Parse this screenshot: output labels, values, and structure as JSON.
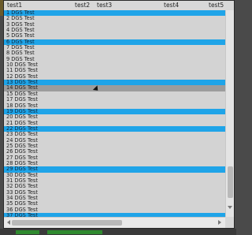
{
  "columns": [
    "test1",
    "test2",
    "test3",
    "test4",
    "test5"
  ],
  "rows": [
    {
      "label": "1 DGS Test",
      "state": "selected"
    },
    {
      "label": "2 DGS Test",
      "state": ""
    },
    {
      "label": "3 DGS Test",
      "state": ""
    },
    {
      "label": "4 DGS Test",
      "state": ""
    },
    {
      "label": "5 DGS Test",
      "state": ""
    },
    {
      "label": "6 DGS Test",
      "state": "selected"
    },
    {
      "label": "7 DGS Test",
      "state": ""
    },
    {
      "label": "8 DGS Test",
      "state": ""
    },
    {
      "label": "9 DGS Test",
      "state": ""
    },
    {
      "label": "10 DGS Test",
      "state": ""
    },
    {
      "label": "11 DGS Test",
      "state": ""
    },
    {
      "label": "12 DGS Test",
      "state": ""
    },
    {
      "label": "13 DGS Test",
      "state": "selected"
    },
    {
      "label": "14 DGS Test",
      "state": "hover"
    },
    {
      "label": "15 DGS Test",
      "state": ""
    },
    {
      "label": "17 DGS Test",
      "state": ""
    },
    {
      "label": "18 DGS Test",
      "state": ""
    },
    {
      "label": "19 DGS Test",
      "state": "selected"
    },
    {
      "label": "20 DGS Test",
      "state": ""
    },
    {
      "label": "21 DGS Test",
      "state": ""
    },
    {
      "label": "22 DGS Test",
      "state": "selected"
    },
    {
      "label": "23 DGS Test",
      "state": ""
    },
    {
      "label": "24 DGS Test",
      "state": ""
    },
    {
      "label": "25 DGS Test",
      "state": ""
    },
    {
      "label": "26 DGS Test",
      "state": ""
    },
    {
      "label": "27 DGS Test",
      "state": ""
    },
    {
      "label": "28 DGS Test",
      "state": ""
    },
    {
      "label": "29 DGS Test",
      "state": "selected"
    },
    {
      "label": "30 DGS Test",
      "state": ""
    },
    {
      "label": "31 DGS Test",
      "state": ""
    },
    {
      "label": "32 DGS Test",
      "state": ""
    },
    {
      "label": "33 DGS Test",
      "state": ""
    },
    {
      "label": "34 DGS Test",
      "state": ""
    },
    {
      "label": "35 DGS Test",
      "state": ""
    },
    {
      "label": "36 DGS Test",
      "state": ""
    },
    {
      "label": "37 DGS Test",
      "state": "selected"
    }
  ],
  "colors": {
    "selected": "#1fa4e8",
    "hover": "#9c9c9c",
    "list_background": "#d3d3d3"
  }
}
